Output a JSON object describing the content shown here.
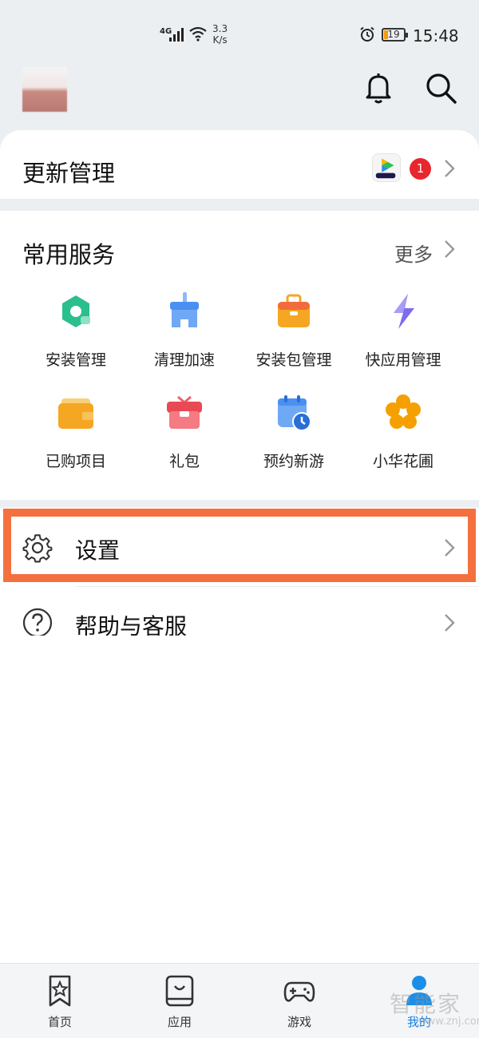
{
  "status_bar": {
    "network": "4G",
    "speed_value": "3.3",
    "speed_unit": "K/s",
    "battery": "19",
    "time": "15:48"
  },
  "header": {
    "icons": [
      "bell-icon",
      "search-icon"
    ]
  },
  "update": {
    "title": "更新管理",
    "badge_count": "1"
  },
  "services": {
    "title": "常用服务",
    "more_label": "更多",
    "items": [
      {
        "label": "安装管理",
        "icon": "install-manage-icon",
        "color": "#2bbf8e"
      },
      {
        "label": "清理加速",
        "icon": "broom-icon",
        "color": "#4a90f0"
      },
      {
        "label": "安装包管理",
        "icon": "package-icon",
        "color": "#f5a623"
      },
      {
        "label": "快应用管理",
        "icon": "lightning-icon",
        "color": "#7b6cf0"
      },
      {
        "label": "已购项目",
        "icon": "wallet-icon",
        "color": "#f5a623"
      },
      {
        "label": "礼包",
        "icon": "gift-icon",
        "color": "#f0606a"
      },
      {
        "label": "预约新游",
        "icon": "calendar-clock-icon",
        "color": "#4a90f0"
      },
      {
        "label": "小华花圃",
        "icon": "flower-icon",
        "color": "#f5a000"
      }
    ]
  },
  "rows": {
    "settings": "设置",
    "help": "帮助与客服"
  },
  "bottom_nav": {
    "items": [
      {
        "label": "首页",
        "icon": "home-star-icon"
      },
      {
        "label": "应用",
        "icon": "app-store-icon"
      },
      {
        "label": "游戏",
        "icon": "gamepad-icon"
      },
      {
        "label": "我的",
        "icon": "user-icon"
      }
    ],
    "active_color": "#1b7fe0"
  },
  "watermark": {
    "text": "智能家",
    "url": "www.znj.com"
  },
  "colors": {
    "highlight": "#f4703f",
    "badge": "#e8262e",
    "background": "#eceff1"
  }
}
